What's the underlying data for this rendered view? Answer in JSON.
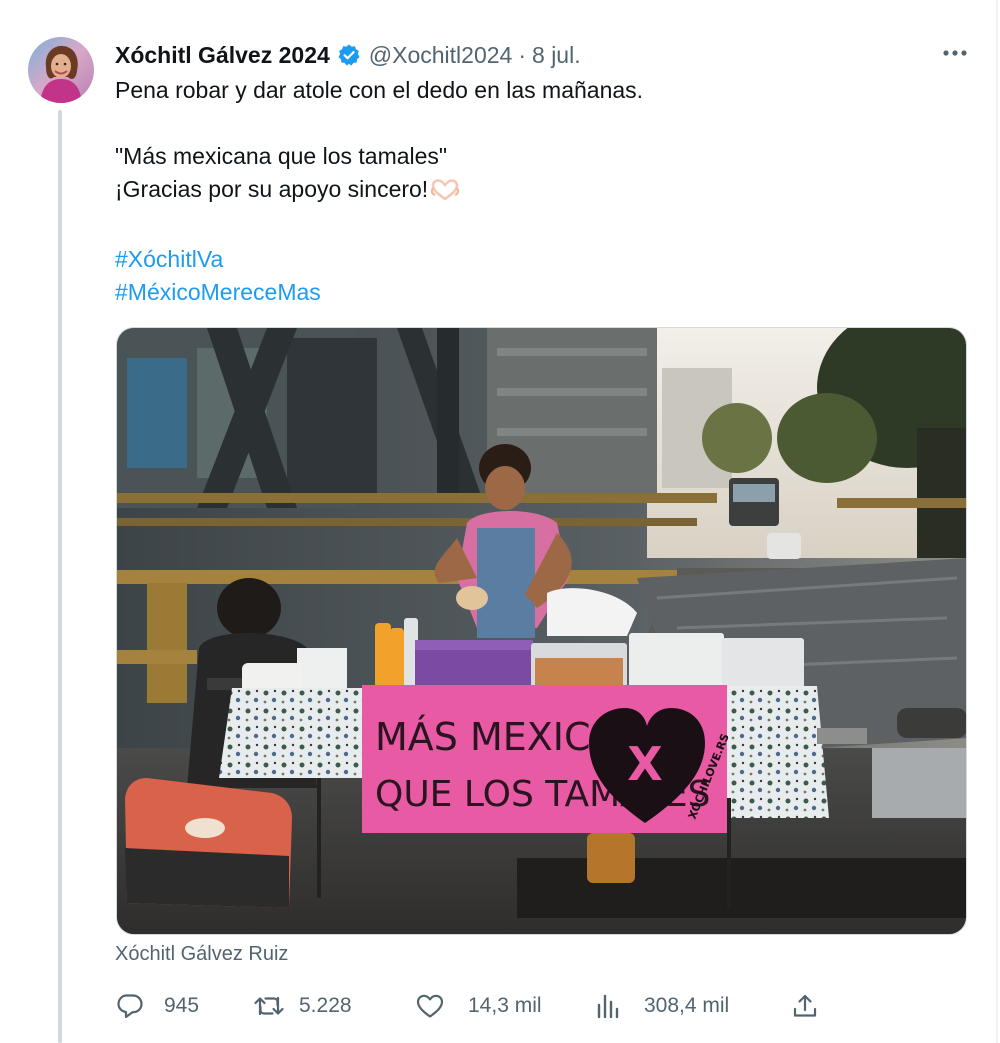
{
  "author": {
    "display_name": "Xóchitl Gálvez 2024",
    "handle": "@Xochitl2024",
    "separator": "·",
    "date": "8 jul."
  },
  "tweet": {
    "line1": "Pena robar y dar atole con el dedo en las mañanas.",
    "line2": "\"Más mexicana que los tamales\"",
    "line3": "¡Gracias por su apoyo sincero!",
    "hashtag1": "#XóchitlVa",
    "hashtag2": "#MéxicoMereceMas"
  },
  "media": {
    "banner_line1": "MÁS MEXICANA",
    "banner_line2": "QUE LOS TAMALES",
    "banner_logo_letter": "X",
    "banner_logo_text": "XOCHILOVE.RS",
    "caption": "Xóchitl Gálvez Ruiz"
  },
  "actions": {
    "replies": "945",
    "reposts": "5.228",
    "likes": "14,3 mil",
    "views": "308,4 mil"
  },
  "icons": {
    "more": "more-horizontal-icon",
    "verified": "verified-badge-icon",
    "reply": "reply-icon",
    "repost": "repost-icon",
    "like": "like-icon",
    "views": "views-icon",
    "share": "share-icon",
    "heart_emoji": "heart-hands-emoji"
  },
  "colors": {
    "link": "#1d9bf0",
    "secondary_text": "#536471",
    "primary_text": "#0f1419",
    "banner_pink": "#e85aa3"
  }
}
